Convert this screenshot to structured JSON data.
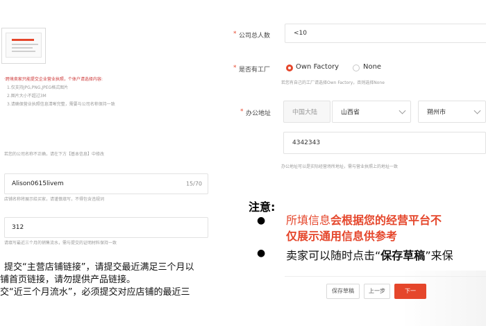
{
  "left": {
    "license_hint": "·跨境卖家只能提交企业营业执照，个体户请选择内容:",
    "license_lines": [
      "1.仅支持JPG,PNG,JPEG格式图片",
      "2.图片大小不超过3M",
      "3.请确保营业执照信息清晰完整，需要与公司名称保持一致"
    ],
    "company_hint": "若您的公司名称不正确，请在下方【基本信息】中修改",
    "store_name_value": "Alison0615livem",
    "store_name_counter": "15/70",
    "store_name_hint": "店铺名称将展示给买家，请谨慎填写，不得包含违规词",
    "sales_value": "312",
    "sales_hint": "请填写最近三个月的销售流水，需与提交的证明材料保持一致",
    "overlay_lines": [
      "提交“主营店铺链接”，请提交最近满足三个月以",
      "铺首页链接，请勿提供产品链接。",
      "交“近三个月流水”，必须提交对应店铺的最近三"
    ]
  },
  "right": {
    "required_mark": "*",
    "employees_label": "公司总人数",
    "employees_value": "<10",
    "factory_label": "是否有工厂",
    "factory_options": [
      "Own Factory",
      "None"
    ],
    "factory_hint": "若您有自己的工厂请选择Own Factory，否则选择None",
    "office_label": "办公地址",
    "country_value": "中国大陆",
    "province_value": "山西省",
    "city_value": "朔州市",
    "address_value": "4342343",
    "address_hint": "办公地址可以是实际经营场所地址，需与营业执照上的地址一致",
    "notice_title": "注意:",
    "notice_line1_red": "所填信息",
    "notice_line1_rest": "会根据您的经营平台不",
    "notice_line2": "仅展示通用信息供参考",
    "notice_line3_a": "卖家可以随时点击“",
    "notice_line3_b": "保存草稿",
    "notice_line3_c": "”来保",
    "save_draft": "保存草稿",
    "prev": "上一步",
    "next": "下一",
    "bullet": "●"
  },
  "colors": {
    "accent": "#e5462b"
  }
}
